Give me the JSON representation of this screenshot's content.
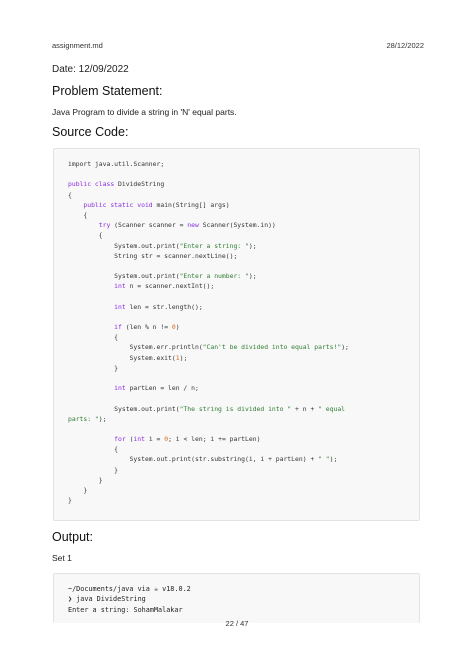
{
  "header": {
    "filename": "assignment.md",
    "date": "28/12/2022"
  },
  "date_line": "Date: 12/09/2022",
  "problem": {
    "heading": "Problem Statement:",
    "text": "Java Program to divide a string in 'N' equal parts."
  },
  "source": {
    "heading": "Source Code:",
    "lines": [
      [
        {
          "t": "import java.util.Scanner;"
        }
      ],
      [],
      [
        {
          "t": "public class",
          "c": "kw"
        },
        {
          "t": " DivideString"
        }
      ],
      [
        {
          "t": "{"
        }
      ],
      [
        {
          "t": "    "
        },
        {
          "t": "public static void",
          "c": "kw"
        },
        {
          "t": " main(String[] args)"
        }
      ],
      [
        {
          "t": "    {"
        }
      ],
      [
        {
          "t": "        "
        },
        {
          "t": "try",
          "c": "kw"
        },
        {
          "t": " (Scanner scanner = "
        },
        {
          "t": "new",
          "c": "kw"
        },
        {
          "t": " Scanner(System.in))"
        }
      ],
      [
        {
          "t": "        {"
        }
      ],
      [
        {
          "t": "            System.out.print("
        },
        {
          "t": "\"Enter a string: \"",
          "c": "str"
        },
        {
          "t": ");"
        }
      ],
      [
        {
          "t": "            String str = scanner.nextLine();"
        }
      ],
      [],
      [
        {
          "t": "            System.out.print("
        },
        {
          "t": "\"Enter a number: \"",
          "c": "str"
        },
        {
          "t": ");"
        }
      ],
      [
        {
          "t": "            "
        },
        {
          "t": "int",
          "c": "kw"
        },
        {
          "t": " n = scanner.nextInt();"
        }
      ],
      [],
      [
        {
          "t": "            "
        },
        {
          "t": "int",
          "c": "kw"
        },
        {
          "t": " len = str.length();"
        }
      ],
      [],
      [
        {
          "t": "            "
        },
        {
          "t": "if",
          "c": "kw"
        },
        {
          "t": " (len % n != "
        },
        {
          "t": "0",
          "c": "num"
        },
        {
          "t": ")"
        }
      ],
      [
        {
          "t": "            {"
        }
      ],
      [
        {
          "t": "                System.err.println("
        },
        {
          "t": "\"Can't be divided into equal parts!\"",
          "c": "str"
        },
        {
          "t": ");"
        }
      ],
      [
        {
          "t": "                System.exit("
        },
        {
          "t": "1",
          "c": "num"
        },
        {
          "t": ");"
        }
      ],
      [
        {
          "t": "            }"
        }
      ],
      [],
      [
        {
          "t": "            "
        },
        {
          "t": "int",
          "c": "kw"
        },
        {
          "t": " partLen = len / n;"
        }
      ],
      [],
      [
        {
          "t": "            System.out.print("
        },
        {
          "t": "\"The string is divided into \"",
          "c": "str"
        },
        {
          "t": " + n + "
        },
        {
          "t": "\" equal",
          "c": "str"
        }
      ],
      [
        {
          "t": "parts: \"",
          "c": "str"
        },
        {
          "t": ");"
        }
      ],
      [],
      [
        {
          "t": "            "
        },
        {
          "t": "for",
          "c": "kw"
        },
        {
          "t": " ("
        },
        {
          "t": "int",
          "c": "kw"
        },
        {
          "t": " i = "
        },
        {
          "t": "0",
          "c": "num"
        },
        {
          "t": "; i < len; i += partLen)"
        }
      ],
      [
        {
          "t": "            {"
        }
      ],
      [
        {
          "t": "                System.out.print(str.substring(i, i + partLen) + "
        },
        {
          "t": "\" \"",
          "c": "str"
        },
        {
          "t": ");"
        }
      ],
      [
        {
          "t": "            }"
        }
      ],
      [
        {
          "t": "        }"
        }
      ],
      [
        {
          "t": "    }"
        }
      ],
      [
        {
          "t": "}"
        }
      ]
    ]
  },
  "output": {
    "heading": "Output:",
    "set_label": "Set 1",
    "lines": [
      "~/Documents/java via ☕ v18.0.2",
      "❯ java DivideString",
      "Enter a string: SohamMalakar"
    ]
  },
  "footer": {
    "page": "22 / 47"
  }
}
